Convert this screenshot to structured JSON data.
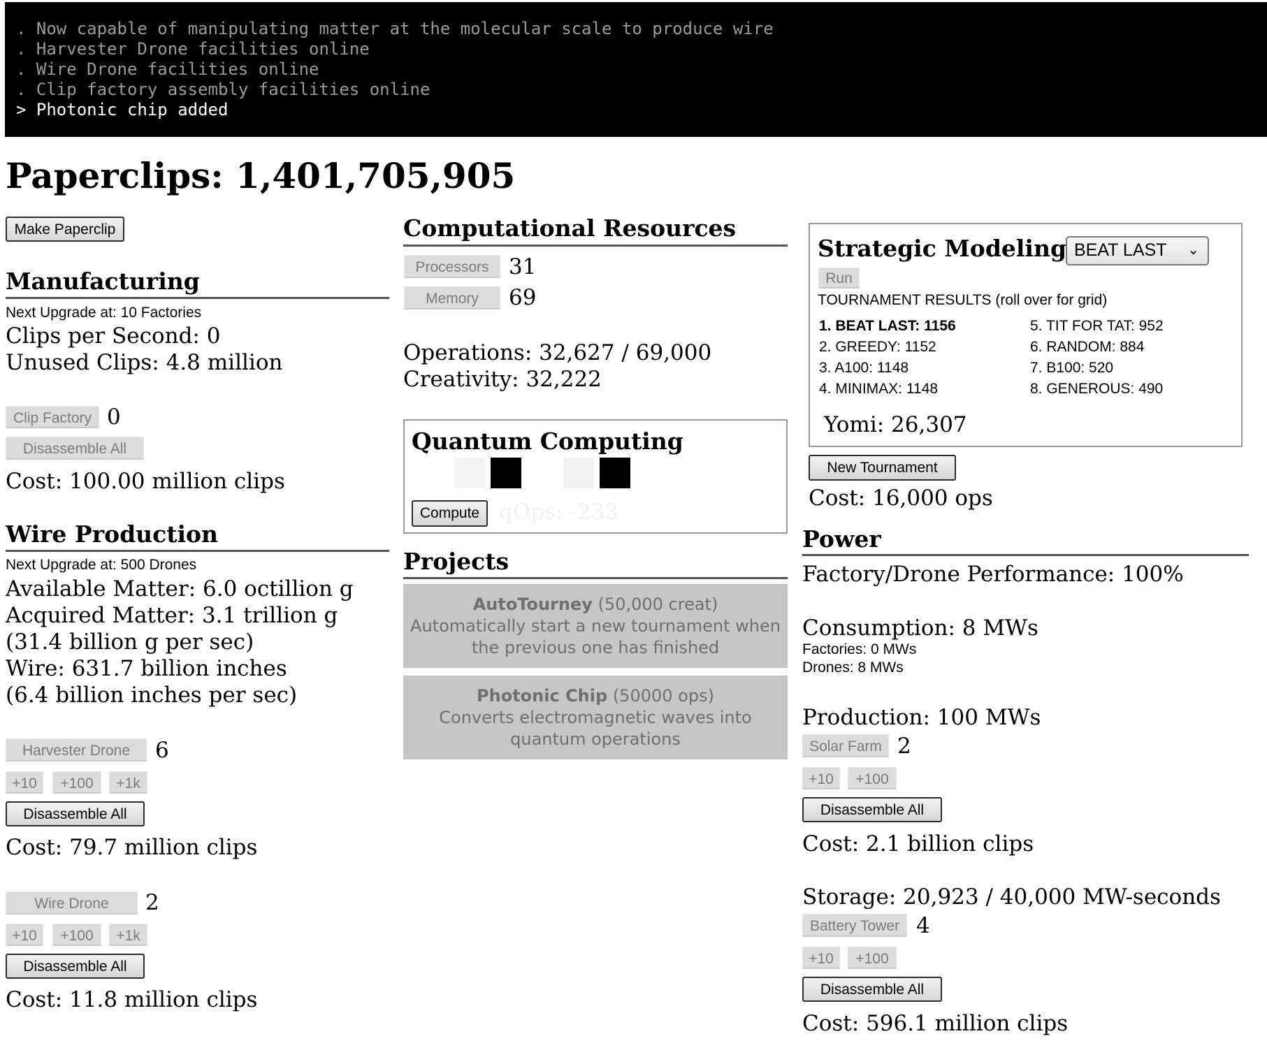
{
  "console": {
    "lines": [
      ". Now capable of manipulating matter at the molecular scale to produce wire",
      ". Harvester Drone facilities online",
      ". Wire Drone facilities online",
      ". Clip factory assembly facilities online",
      "> Photonic chip added"
    ]
  },
  "title": "Paperclips: 1,401,705,905",
  "make_paperclip": "Make Paperclip",
  "manufacturing": {
    "heading": "Manufacturing",
    "next_upgrade": "Next Upgrade at: 10 Factories",
    "clips_per_second": "Clips per Second: 0",
    "unused_clips": "Unused Clips: 4.8 million",
    "clip_factory": {
      "label": "Clip Factory",
      "count": "0",
      "disassemble": "Disassemble All",
      "cost": "Cost: 100.00 million clips"
    }
  },
  "wire": {
    "heading": "Wire Production",
    "next_upgrade": "Next Upgrade at: 500 Drones",
    "available": "Available Matter: 6.0 octillion g",
    "acquired": "Acquired Matter: 3.1 trillion g",
    "acquired_rate": "(31.4 billion g per sec)",
    "wire": "Wire: 631.7 billion inches",
    "wire_rate": "(6.4 billion inches per sec)",
    "harvester": {
      "label": "Harvester Drone",
      "count": "6",
      "plus10": "+10",
      "plus100": "+100",
      "plus1k": "+1k",
      "disassemble": "Disassemble All",
      "cost": "Cost: 79.7 million clips"
    },
    "wire_drone": {
      "label": "Wire Drone",
      "count": "2",
      "plus10": "+10",
      "plus100": "+100",
      "plus1k": "+1k",
      "disassemble": "Disassemble All",
      "cost": "Cost: 11.8 million clips"
    }
  },
  "compute": {
    "heading": "Computational Resources",
    "processors_label": "Processors",
    "processors": "31",
    "memory_label": "Memory",
    "memory": "69",
    "operations": "Operations: 32,627 / 69,000",
    "creativity": "Creativity: 32,222"
  },
  "quantum": {
    "heading": "Quantum Computing",
    "compute": "Compute",
    "qops": "qOps: -233",
    "chips": [
      0.04,
      1.0,
      0.0,
      0.05,
      1.0
    ]
  },
  "projects": {
    "heading": "Projects",
    "items": [
      {
        "name": "AutoTourney",
        "cost": "(50,000 creat)",
        "desc": "Automatically start a new tournament when the previous one has finished"
      },
      {
        "name": "Photonic Chip",
        "cost": "(50000 ops)",
        "desc": "Converts electromagnetic waves into quantum operations"
      }
    ]
  },
  "strategy": {
    "heading": "Strategic Modeling",
    "selected": "BEAT LAST",
    "run": "Run",
    "results_label": "TOURNAMENT RESULTS (roll over for grid)",
    "results_left": [
      "1. BEAT LAST: 1156",
      "2. GREEDY: 1152",
      "3. A100: 1148",
      "4. MINIMAX: 1148"
    ],
    "results_right": [
      "5. TIT FOR TAT: 952",
      "6. RANDOM: 884",
      "7. B100: 520",
      "8. GENEROUS: 490"
    ],
    "yomi": "Yomi: 26,307",
    "new_tournament": "New Tournament",
    "cost": "Cost: 16,000 ops"
  },
  "power": {
    "heading": "Power",
    "performance": "Factory/Drone Performance: 100%",
    "consumption": "Consumption: 8 MWs",
    "factories": "Factories: 0 MWs",
    "drones": "Drones: 8 MWs",
    "production": "Production: 100 MWs",
    "solar": {
      "label": "Solar Farm",
      "count": "2",
      "plus10": "+10",
      "plus100": "+100",
      "disassemble": "Disassemble All",
      "cost": "Cost: 2.1 billion clips"
    },
    "storage": "Storage: 20,923 / 40,000 MW-seconds",
    "battery": {
      "label": "Battery Tower",
      "count": "4",
      "plus10": "+10",
      "plus100": "+100",
      "disassemble": "Disassemble All",
      "cost": "Cost: 596.1 million clips"
    }
  }
}
